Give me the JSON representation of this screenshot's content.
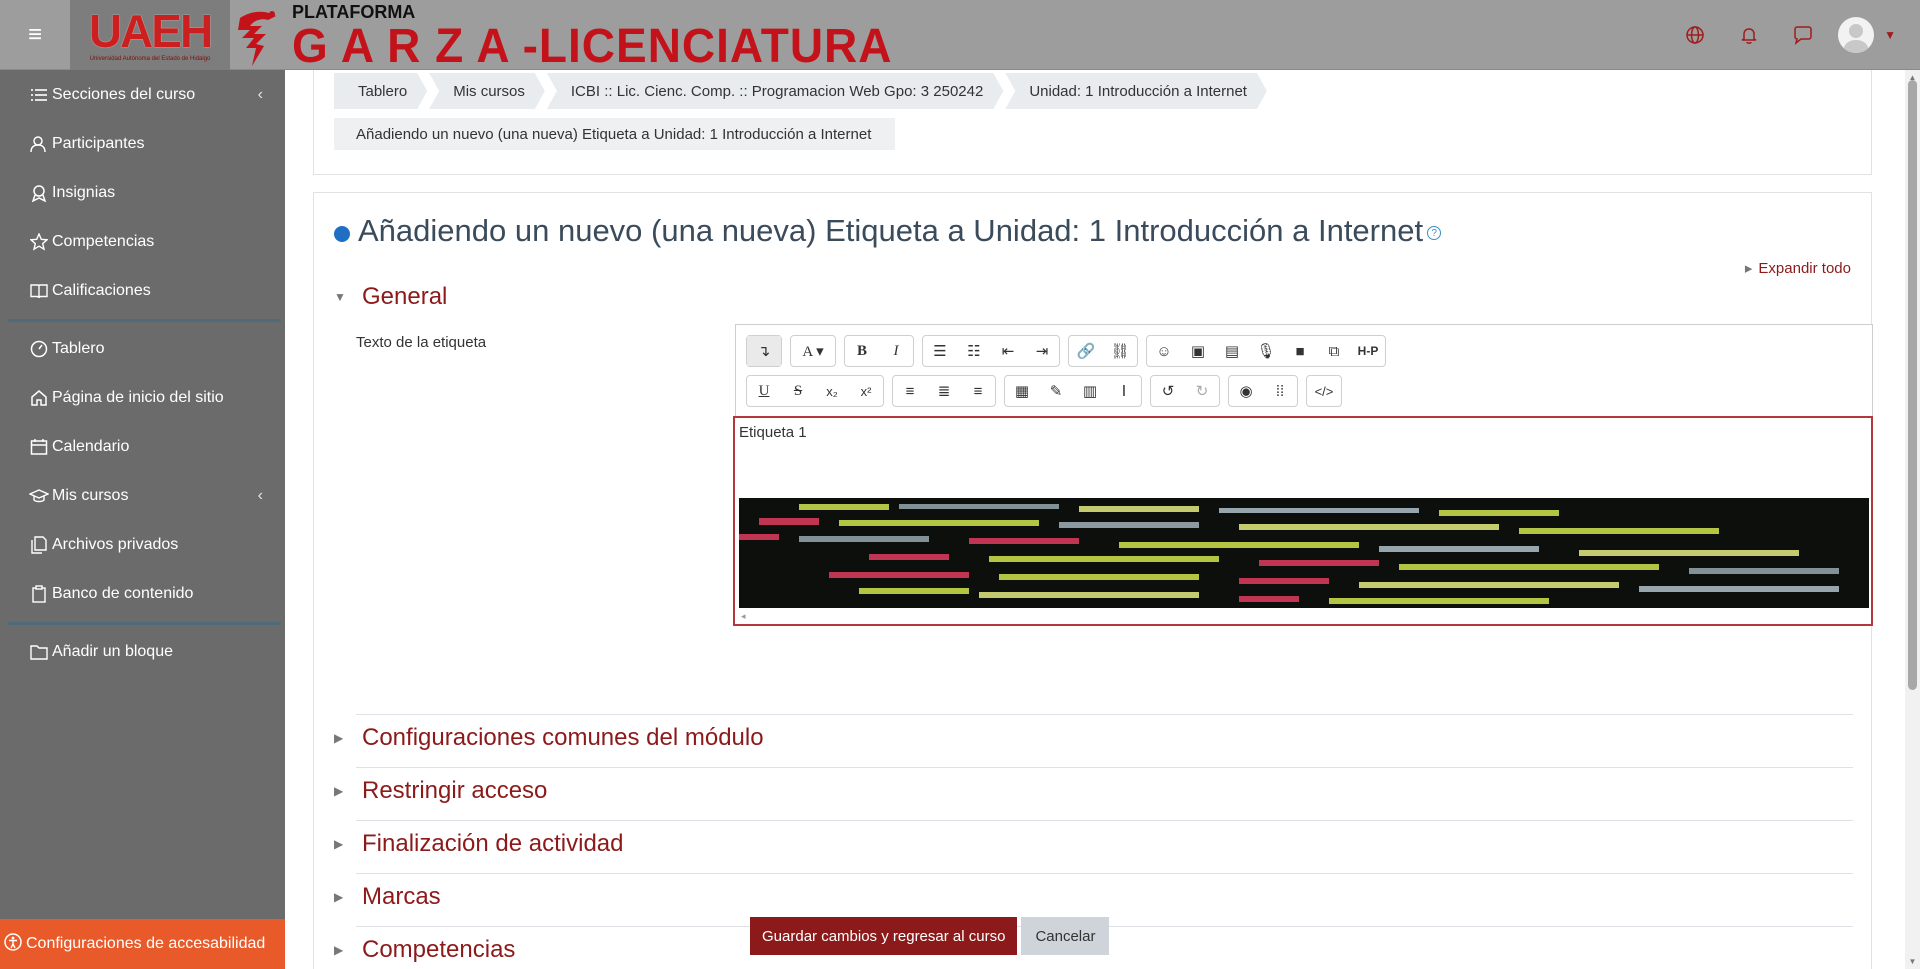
{
  "header": {
    "menu_icon": "hamburger-icon",
    "logo_text": "UAEH",
    "logo_subtext": "Universidad Autónoma del Estado de Hidalgo",
    "brand_top": "PLATAFORMA",
    "brand_main": "G A R Z A -LICENCIATURA",
    "icons": [
      "globe-icon",
      "bell-icon",
      "chat-icon"
    ],
    "brand_color": "#c4121a"
  },
  "sidebar": {
    "items": [
      {
        "label": "Secciones del curso",
        "icon": "list-icon",
        "chevron": true
      },
      {
        "label": "Participantes",
        "icon": "users-icon"
      },
      {
        "label": "Insignias",
        "icon": "badge-icon"
      },
      {
        "label": "Competencias",
        "icon": "star-icon"
      },
      {
        "label": "Calificaciones",
        "icon": "gradebook-icon"
      },
      {
        "label": "Tablero",
        "icon": "dashboard-icon"
      },
      {
        "label": "Página de inicio del sitio",
        "icon": "home-icon"
      },
      {
        "label": "Calendario",
        "icon": "calendar-icon"
      },
      {
        "label": "Mis cursos",
        "icon": "graduation-cap-icon",
        "chevron": true
      },
      {
        "label": "Archivos privados",
        "icon": "files-icon"
      },
      {
        "label": "Banco de contenido",
        "icon": "clipboard-icon"
      },
      {
        "label": "Añadir un bloque",
        "icon": "folder-icon"
      }
    ],
    "accessibility": "Configuraciones de accesabilidad"
  },
  "breadcrumb": {
    "items": [
      "Tablero",
      "Mis cursos",
      "ICBI :: Lic. Cienc. Comp. :: Programacion Web Gpo: 3 250242",
      "Unidad: 1 Introducción a Internet"
    ],
    "current": "Añadiendo un nuevo (una nueva) Etiqueta a Unidad: 1 Introducción a Internet"
  },
  "page": {
    "title": "Añadiendo un nuevo (una nueva) Etiqueta a Unidad: 1 Introducción a Internet",
    "expand_all": "Expandir todo"
  },
  "sections": {
    "general": "General",
    "collapsed": [
      "Configuraciones comunes del módulo",
      "Restringir acceso",
      "Finalización de actividad",
      "Marcas",
      "Competencias"
    ]
  },
  "form": {
    "label_text_label": "Texto de la etiqueta",
    "editor_content": "Etiqueta 1",
    "save_button": "Guardar cambios y regresar al curso",
    "cancel_button": "Cancelar"
  },
  "editor_toolbar": {
    "row1": [
      "show-more-icon",
      "font-color-icon",
      "bold-icon",
      "italic-icon",
      "bullet-list-icon",
      "numbered-list-icon",
      "outdent-icon",
      "indent-icon",
      "link-icon",
      "unlink-icon",
      "emoji-icon",
      "image-icon",
      "media-icon",
      "record-audio-icon",
      "record-video-icon",
      "manage-files-icon",
      "h5p-icon"
    ],
    "row2": [
      "underline-icon",
      "strikethrough-icon",
      "subscript-icon",
      "superscript-icon",
      "align-left-icon",
      "align-center-icon",
      "align-right-icon",
      "equation-icon",
      "special-chars-icon",
      "table-icon",
      "clear-format-icon",
      "undo-icon",
      "redo-icon",
      "accessibility-checker-icon",
      "screenreader-helper-icon",
      "html-icon"
    ],
    "h5p_label": "H-P"
  },
  "colors": {
    "accent": "#8c1a1a",
    "sidebar_bg": "#6b6b6b",
    "topbar_bg": "#9d9d9d",
    "accessibility_bg": "#e85a2a"
  }
}
